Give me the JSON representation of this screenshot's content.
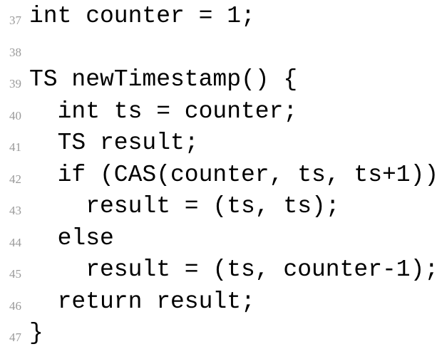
{
  "document": {
    "kind": "code-listing",
    "language": "c-like-pseudocode",
    "background_color": "#ffffff",
    "code_color": "#000000",
    "line_number_color": "#9a9a9a",
    "first_line_number": 37,
    "last_line_number": 47
  },
  "code": {
    "lines": [
      {
        "number": "37",
        "text": "int counter = 1;"
      },
      {
        "number": "38",
        "text": ""
      },
      {
        "number": "39",
        "text": "TS newTimestamp() {"
      },
      {
        "number": "40",
        "text": "  int ts = counter;"
      },
      {
        "number": "41",
        "text": "  TS result;"
      },
      {
        "number": "42",
        "text": "  if (CAS(counter, ts, ts+1))"
      },
      {
        "number": "43",
        "text": "    result = (ts, ts);"
      },
      {
        "number": "44",
        "text": "  else"
      },
      {
        "number": "45",
        "text": "    result = (ts, counter-1);"
      },
      {
        "number": "46",
        "text": "  return result;"
      },
      {
        "number": "47",
        "text": "}"
      }
    ]
  }
}
